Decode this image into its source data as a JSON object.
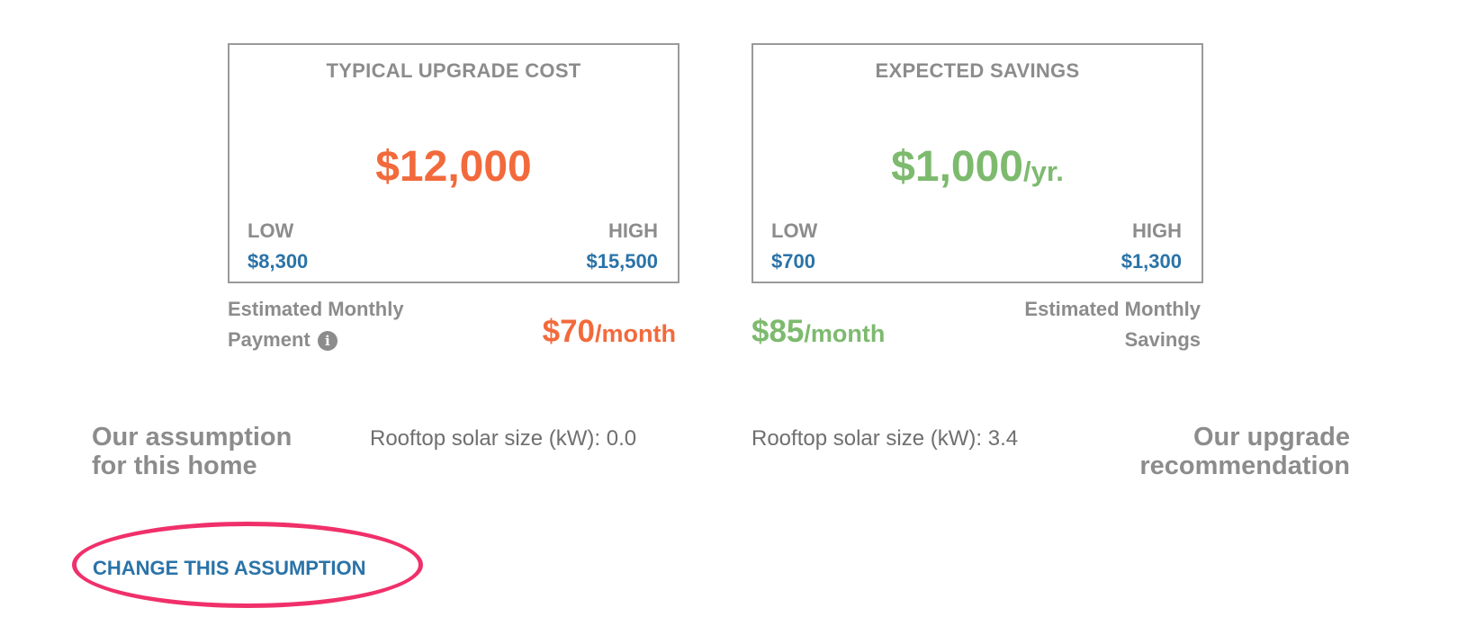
{
  "colors": {
    "cost_accent": "#f26a3c",
    "savings_accent": "#7dba6e",
    "link_blue": "#2a73a8",
    "muted_gray": "#8c8c8c",
    "annotation_pink": "#f0306a"
  },
  "cost_card": {
    "title": "TYPICAL UPGRADE COST",
    "value": "$12,000",
    "low_label": "LOW",
    "low_value": "$8,300",
    "high_label": "HIGH",
    "high_value": "$15,500"
  },
  "savings_card": {
    "title": "EXPECTED SAVINGS",
    "value": "$1,000",
    "unit": "/yr.",
    "low_label": "LOW",
    "low_value": "$700",
    "high_label": "HIGH",
    "high_value": "$1,300"
  },
  "monthly_payment": {
    "label_line1": "Estimated Monthly",
    "label_line2": "Payment",
    "info_icon": "info-circle-icon",
    "amount": "$70",
    "unit": "/month"
  },
  "monthly_savings": {
    "label_line1": "Estimated Monthly",
    "label_line2": "Savings",
    "amount": "$85",
    "unit": "/month"
  },
  "assumption": {
    "heading_line1": "Our assumption",
    "heading_line2": "for this home",
    "solar_text": "Rooftop solar size (kW): 0.0"
  },
  "recommendation": {
    "heading_line1": "Our upgrade",
    "heading_line2": "recommendation",
    "solar_text": "Rooftop solar size (kW): 3.4"
  },
  "change_link": {
    "label": "CHANGE THIS ASSUMPTION"
  }
}
